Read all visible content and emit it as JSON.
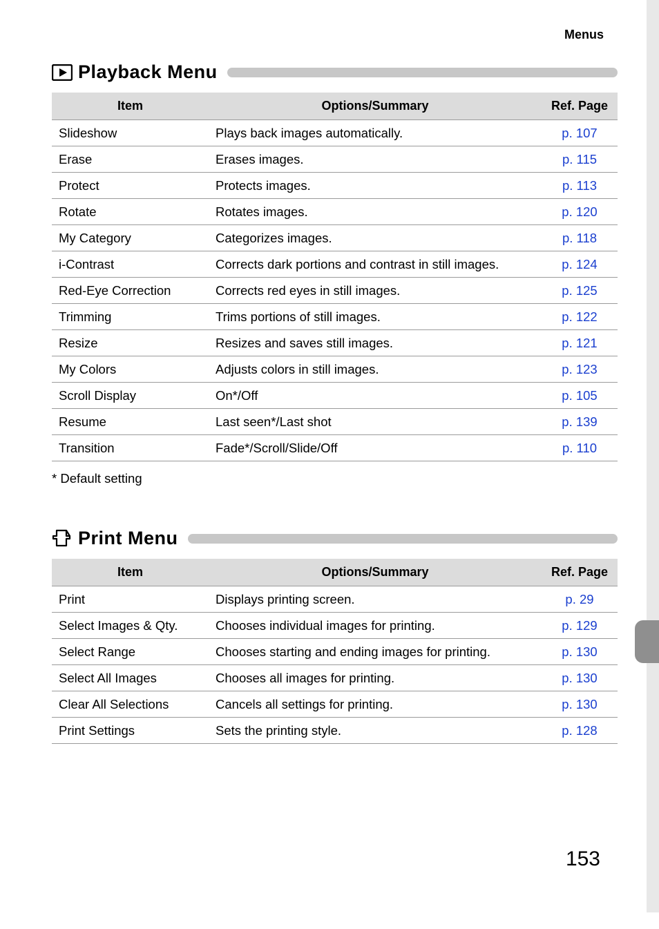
{
  "topLabel": "Menus",
  "pageNumber": "153",
  "playback": {
    "iconAlt": "playback-icon",
    "title": "Playback Menu",
    "headers": {
      "item": "Item",
      "options": "Options/Summary",
      "ref": "Ref. Page"
    },
    "rows": [
      {
        "item": "Slideshow",
        "options": "Plays back images automatically.",
        "ref": "p. 107"
      },
      {
        "item": "Erase",
        "options": "Erases images.",
        "ref": "p. 115"
      },
      {
        "item": "Protect",
        "options": "Protects images.",
        "ref": "p. 113"
      },
      {
        "item": "Rotate",
        "options": "Rotates images.",
        "ref": "p. 120"
      },
      {
        "item": "My Category",
        "options": "Categorizes images.",
        "ref": "p. 118"
      },
      {
        "item": "i-Contrast",
        "options": "Corrects dark portions and contrast in still images.",
        "ref": "p. 124"
      },
      {
        "item": "Red-Eye Correction",
        "options": "Corrects red eyes in still images.",
        "ref": "p. 125"
      },
      {
        "item": "Trimming",
        "options": "Trims portions of still images.",
        "ref": "p. 122"
      },
      {
        "item": "Resize",
        "options": "Resizes and saves still images.",
        "ref": "p. 121"
      },
      {
        "item": "My Colors",
        "options": "Adjusts colors in still images.",
        "ref": "p. 123"
      },
      {
        "item": "Scroll Display",
        "options": "On*/Off",
        "ref": "p. 105"
      },
      {
        "item": "Resume",
        "options": "Last seen*/Last shot",
        "ref": "p. 139"
      },
      {
        "item": "Transition",
        "options": "Fade*/Scroll/Slide/Off",
        "ref": "p. 110"
      }
    ],
    "footnote": "* Default setting"
  },
  "print": {
    "iconAlt": "print-icon",
    "title": "Print Menu",
    "headers": {
      "item": "Item",
      "options": "Options/Summary",
      "ref": "Ref. Page"
    },
    "rows": [
      {
        "item": "Print",
        "options": "Displays printing screen.",
        "ref": "p. 29"
      },
      {
        "item": "Select Images & Qty.",
        "options": "Chooses individual images for printing.",
        "ref": "p. 129"
      },
      {
        "item": "Select Range",
        "options": "Chooses starting and ending images for printing.",
        "ref": "p. 130"
      },
      {
        "item": "Select All Images",
        "options": "Chooses all images for printing.",
        "ref": "p. 130"
      },
      {
        "item": "Clear All Selections",
        "options": "Cancels all settings for printing.",
        "ref": "p. 130"
      },
      {
        "item": "Print Settings",
        "options": "Sets the printing style.",
        "ref": "p. 128"
      }
    ]
  }
}
